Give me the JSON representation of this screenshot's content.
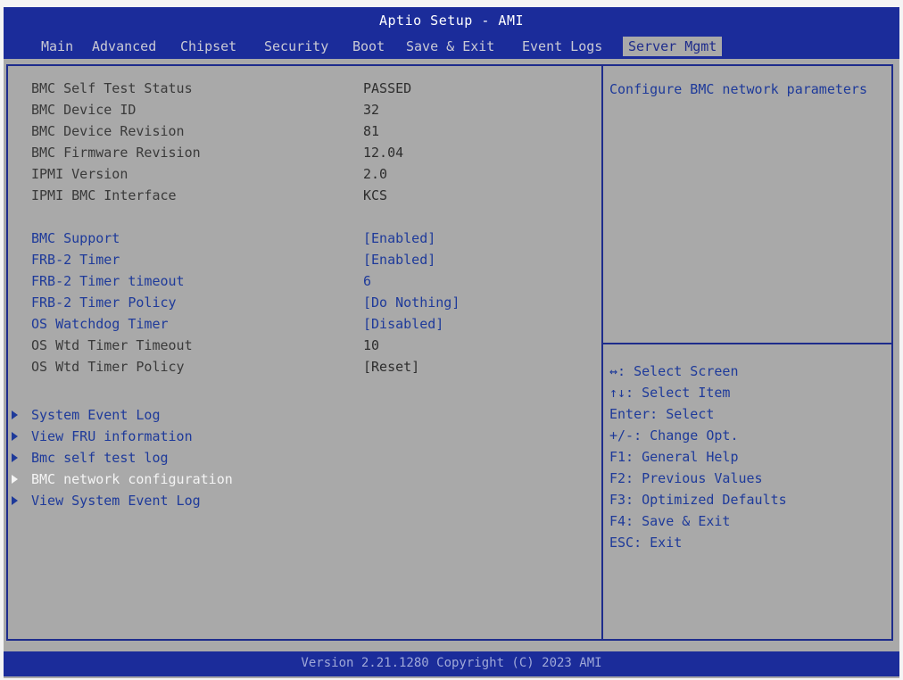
{
  "app": {
    "title": "Aptio Setup - AMI",
    "version": "Version 2.21.1280 Copyright (C) 2023 AMI"
  },
  "tabs": [
    {
      "label": "Main"
    },
    {
      "label": "Advanced"
    },
    {
      "label": "Chipset"
    },
    {
      "label": "Security"
    },
    {
      "label": "Boot"
    },
    {
      "label": "Save & Exit"
    },
    {
      "label": "Event Logs"
    },
    {
      "label": "Server Mgmt",
      "active": true
    }
  ],
  "info": [
    {
      "label": "BMC Self Test Status",
      "value": "PASSED"
    },
    {
      "label": "BMC Device ID",
      "value": "32"
    },
    {
      "label": "BMC Device Revision",
      "value": "81"
    },
    {
      "label": "BMC Firmware Revision",
      "value": "12.04"
    },
    {
      "label": "IPMI Version",
      "value": "2.0"
    },
    {
      "label": "IPMI BMC Interface",
      "value": "KCS"
    }
  ],
  "settings": [
    {
      "label": "BMC Support",
      "value": "[Enabled]"
    },
    {
      "label": "FRB-2 Timer",
      "value": "[Enabled]"
    },
    {
      "label": "FRB-2 Timer timeout",
      "value": "6"
    },
    {
      "label": "FRB-2 Timer Policy",
      "value": "[Do Nothing]"
    },
    {
      "label": "OS Watchdog Timer",
      "value": "[Disabled]"
    },
    {
      "label": "OS Wtd Timer Timeout",
      "value": "10"
    },
    {
      "label": "OS Wtd Timer Policy",
      "value": "[Reset]"
    }
  ],
  "submenus": [
    {
      "label": "System Event Log"
    },
    {
      "label": "View FRU information"
    },
    {
      "label": "Bmc self test log"
    },
    {
      "label": "BMC network configuration",
      "selected": true
    },
    {
      "label": "View System Event Log"
    }
  ],
  "help": {
    "text": "Configure BMC network parameters"
  },
  "keys": [
    {
      "text": "↔: Select Screen"
    },
    {
      "text": "↑↓: Select Item"
    },
    {
      "text": "Enter: Select"
    },
    {
      "text": "+/-: Change Opt."
    },
    {
      "text": "F1: General Help"
    },
    {
      "text": "F2: Previous Values"
    },
    {
      "text": "F3: Optimized Defaults"
    },
    {
      "text": "F4: Save & Exit"
    },
    {
      "text": "ESC: Exit"
    }
  ],
  "colors": {
    "header_blue": "#1b2c9a",
    "background_gray": "#a9a9a9",
    "item_blue": "#1e3a9a",
    "selected_white": "#f4f4f4"
  }
}
